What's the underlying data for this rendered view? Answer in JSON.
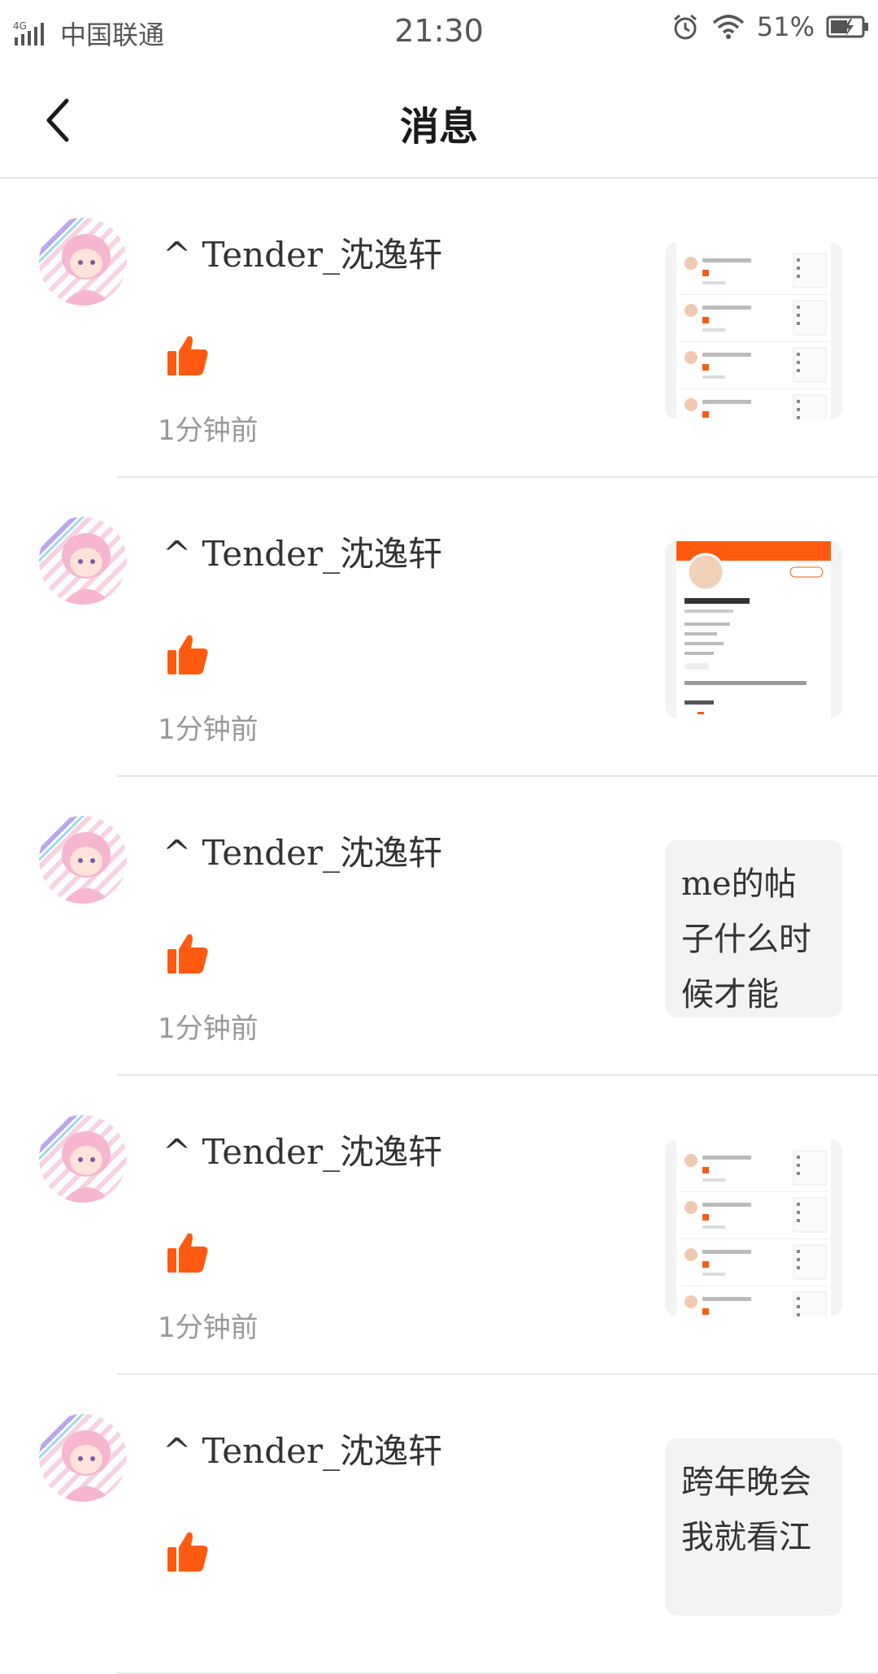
{
  "status_bar": {
    "network": "4G",
    "carrier": "中国联通",
    "time": "21:30",
    "battery_percent": "51%"
  },
  "header": {
    "title": "消息"
  },
  "colors": {
    "accent": "#FF5A0F",
    "avatar_pink": "#F6B6CF"
  },
  "messages": [
    {
      "username": "^ Tender_沈逸轩",
      "icon": "thumbs-up-icon",
      "time": "1分钟前",
      "thumb_type": "screenshot-list",
      "thumb_text": ""
    },
    {
      "username": "^ Tender_沈逸轩",
      "icon": "thumbs-up-icon",
      "time": "1分钟前",
      "thumb_type": "screenshot-profile",
      "thumb_text": ""
    },
    {
      "username": "^ Tender_沈逸轩",
      "icon": "thumbs-up-icon",
      "time": "1分钟前",
      "thumb_type": "text",
      "thumb_text": "me的帖子什么时候才能到…"
    },
    {
      "username": "^ Tender_沈逸轩",
      "icon": "thumbs-up-icon",
      "time": "1分钟前",
      "thumb_type": "screenshot-list",
      "thumb_text": ""
    },
    {
      "username": "^ Tender_沈逸轩",
      "icon": "thumbs-up-icon",
      "time": "",
      "thumb_type": "text",
      "thumb_text": "跨年晚会我就看江"
    }
  ]
}
